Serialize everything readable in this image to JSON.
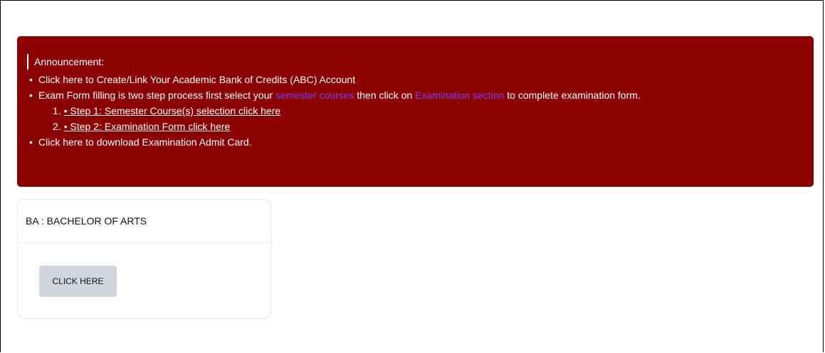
{
  "announcement": {
    "title": "Announcement:",
    "items": [
      {
        "text": "Click here to Create/Link Your Academic Bank of Credits (ABC) Account"
      },
      {
        "text_a": "Exam Form filling is two step process first select your ",
        "link_a": "semester courses",
        "text_b": " then click on ",
        "link_b": "Examination section",
        "text_c": " to complete examination form."
      },
      {
        "text": "Click here to download Examination Admit Card."
      }
    ],
    "steps": [
      {
        "num": "1.",
        "label": "• Step 1: Semester Course(s) selection click here"
      },
      {
        "num": "2.",
        "label": "• Step 2: Examination Form click here"
      }
    ]
  },
  "program_card": {
    "title": "BA : BACHELOR OF ARTS",
    "button_label": "CLICK HERE"
  },
  "colors": {
    "announcement_bg": "#8b0000",
    "highlight": "#7b3ff2",
    "button_bg": "#d1d5de"
  }
}
